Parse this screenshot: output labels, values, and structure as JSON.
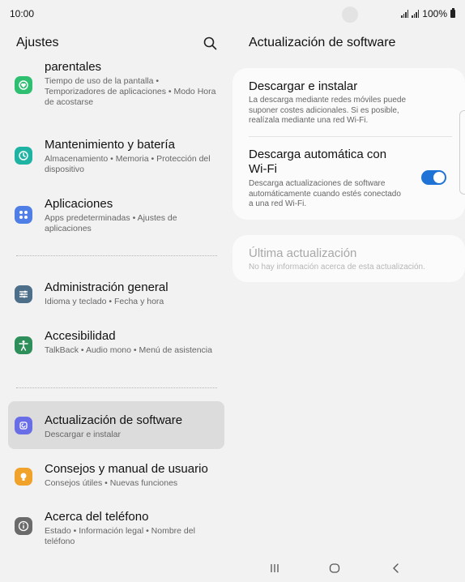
{
  "status_bar": {
    "time": "10:00",
    "battery": "100%"
  },
  "left_panel": {
    "title": "Ajustes",
    "items": [
      {
        "title": "parentales",
        "subtitle": "Tiempo de uso de la pantalla • Temporizadores de aplicaciones • Modo Hora de acostarse",
        "icon": "parental-controls-icon",
        "color": "#2fbf71"
      },
      {
        "title": "Mantenimiento y batería",
        "subtitle": "Almacenamiento • Memoria • Protección del dispositivo",
        "icon": "battery-care-icon",
        "color": "#1fb3a4"
      },
      {
        "title": "Aplicaciones",
        "subtitle": "Apps predeterminadas • Ajustes de aplicaciones",
        "icon": "apps-icon",
        "color": "#4f7fe6"
      },
      {
        "title": "Administración general",
        "subtitle": "Idioma y teclado • Fecha y hora",
        "icon": "general-management-icon",
        "color": "#4d6f8a"
      },
      {
        "title": "Accesibilidad",
        "subtitle": "TalkBack • Audio mono • Menú de asistencia",
        "icon": "accessibility-icon",
        "color": "#2f8f5a"
      },
      {
        "title": "Actualización de software",
        "subtitle": "Descargar e instalar",
        "icon": "software-update-icon",
        "color": "#6a6ee6"
      },
      {
        "title": "Consejos y manual de usuario",
        "subtitle": "Consejos útiles • Nuevas funciones",
        "icon": "tips-icon",
        "color": "#f0a22a"
      },
      {
        "title": "Acerca del teléfono",
        "subtitle": "Estado • Información legal • Nombre del teléfono",
        "icon": "about-phone-icon",
        "color": "#6b6b6b"
      }
    ]
  },
  "right_panel": {
    "title": "Actualización de software",
    "download_install": {
      "title": "Descargar e instalar",
      "subtitle": "La descarga mediante redes móviles puede suponer costes adicionales. Si es posible, realízala mediante una red Wi-Fi."
    },
    "auto_download": {
      "title": "Descarga automática con Wi-Fi",
      "subtitle": "Descarga actualizaciones de software automáticamente cuando estés conectado a una red Wi-Fi.",
      "enabled": true
    },
    "last_update": {
      "title": "Última actualización",
      "subtitle": "No hay información acerca de esta actualización."
    }
  },
  "colors": {
    "accent": "#1f73d6",
    "background": "#f2f2f2",
    "card": "#fbfbfb",
    "selected": "#dcdcdc"
  }
}
